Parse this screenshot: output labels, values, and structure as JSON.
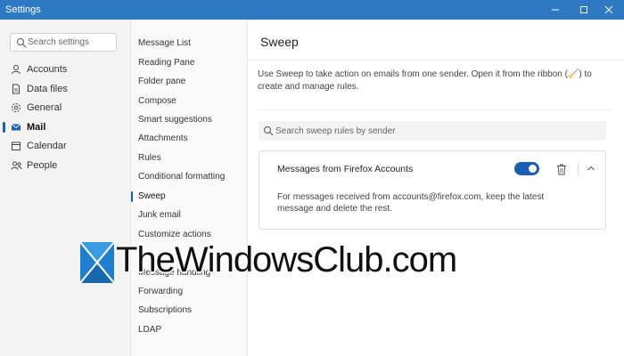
{
  "window": {
    "title": "Settings",
    "controls": {
      "minimize": "minimize-icon",
      "maximize": "maximize-icon",
      "close": "close-icon"
    }
  },
  "sidebar": {
    "search_placeholder": "Search settings",
    "items": [
      {
        "label": "Accounts",
        "icon": "person-icon",
        "active": false
      },
      {
        "label": "Data files",
        "icon": "file-icon",
        "active": false
      },
      {
        "label": "General",
        "icon": "gear-icon",
        "active": false
      },
      {
        "label": "Mail",
        "icon": "mail-icon",
        "active": true
      },
      {
        "label": "Calendar",
        "icon": "calendar-icon",
        "active": false
      },
      {
        "label": "People",
        "icon": "people-icon",
        "active": false
      }
    ]
  },
  "submenu": {
    "items": [
      {
        "label": "Message List",
        "active": false
      },
      {
        "label": "Reading Pane",
        "active": false
      },
      {
        "label": "Folder pane",
        "active": false
      },
      {
        "label": "Compose",
        "active": false
      },
      {
        "label": "Smart suggestions",
        "active": false
      },
      {
        "label": "Attachments",
        "active": false
      },
      {
        "label": "Rules",
        "active": false
      },
      {
        "label": "Conditional formatting",
        "active": false
      },
      {
        "label": "Sweep",
        "active": true
      },
      {
        "label": "Junk email",
        "active": false
      },
      {
        "label": "Customize actions",
        "active": false
      },
      {
        "label": "Message handling",
        "active": false
      },
      {
        "label": "Forwarding",
        "active": false
      },
      {
        "label": "Subscriptions",
        "active": false
      },
      {
        "label": "LDAP",
        "active": false
      }
    ]
  },
  "main": {
    "title": "Sweep",
    "description": "Use Sweep to take action on emails from one sender. Open it from the ribbon (🧹) to create and manage rules.",
    "search_placeholder": "Search sweep rules by sender",
    "rules": [
      {
        "title": "Messages from Firefox Accounts",
        "enabled": true,
        "description": "For messages received from accounts@firefox.com, keep the latest message and delete the rest."
      }
    ]
  },
  "watermark": {
    "text": "TheWindowsClub.com"
  },
  "colors": {
    "titlebar": "#2d7ac2",
    "accent": "#1a5fb4",
    "sidebar_bg": "#f3f3f3"
  }
}
